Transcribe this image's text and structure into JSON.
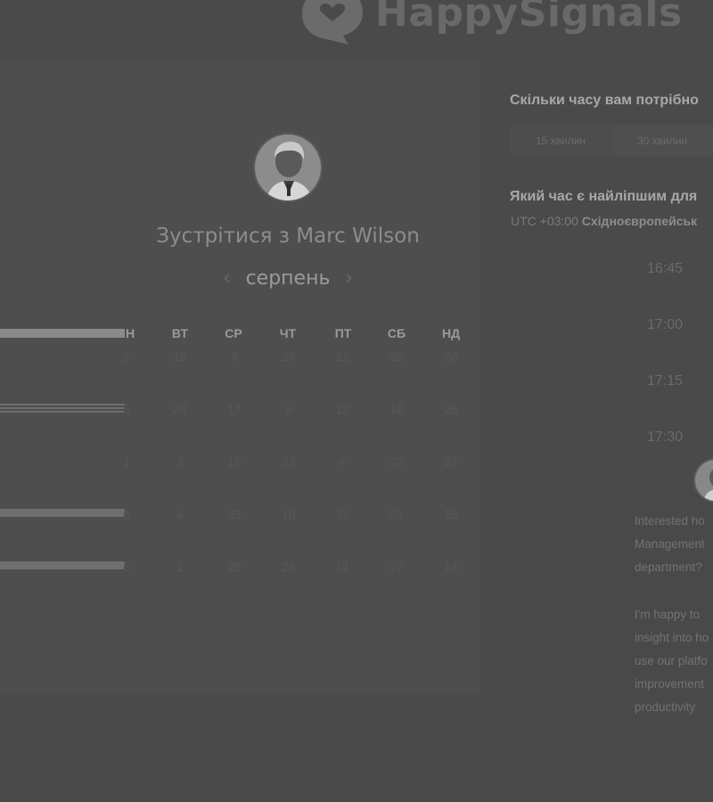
{
  "brand": {
    "name": "HappySignals",
    "icon": "heart-chat-logo-icon"
  },
  "meeting": {
    "title": "Зустрітися з Marc Wilson",
    "avatar": "person-in-suit-avatar"
  },
  "calendar": {
    "month": "серпень",
    "prev_icon": "chevron-left-icon",
    "next_icon": "chevron-right-icon",
    "weekdays": [
      "Н",
      "ВТ",
      "СР",
      "ЧТ",
      "ПТ",
      "СБ",
      "НД"
    ],
    "weeks": [
      [
        "2",
        "15",
        "8",
        "25",
        "21",
        "22",
        "26"
      ],
      [
        "5",
        "28",
        "17",
        "9",
        "12",
        "18",
        "26"
      ],
      [
        "1",
        "3",
        "16",
        "23",
        "4",
        "22",
        "27"
      ],
      [
        "6",
        "4",
        "23",
        "10",
        "31",
        "21",
        "19"
      ],
      [
        "6",
        "1",
        "29",
        "29",
        "14",
        "27",
        "14"
      ]
    ]
  },
  "duration": {
    "question": "Скільки часу вам потрібно",
    "options": [
      "15 хвилин",
      "30 хвилин"
    ]
  },
  "time": {
    "question": "Який час є найліпшим для",
    "timezone_offset": "UTC +03:00",
    "timezone_name": "Східноєвропейськ",
    "slots": [
      "16:45",
      "17:00",
      "17:15",
      "17:30"
    ]
  },
  "card": {
    "lines": [
      "Interested ho",
      "Management",
      "department?",
      "",
      "I'm happy to",
      "insight into ho",
      "use our platfo",
      "improvement",
      "productivity"
    ]
  },
  "colors": {
    "overlay": "#4a4a4a",
    "panel": "#4e4e4e",
    "accent_bar": "#8a8a8a"
  }
}
